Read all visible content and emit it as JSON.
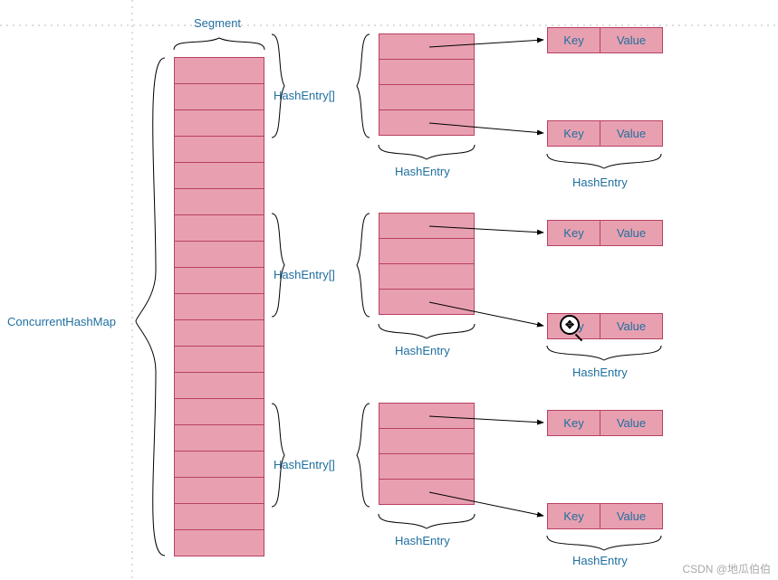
{
  "labels": {
    "root": "ConcurrentHashMap",
    "segment": "Segment",
    "hashEntryArr": "HashEntry[]",
    "hashEntry": "HashEntry",
    "key": "Key",
    "value": "Value"
  },
  "segmentCount": 19,
  "entryRowsPerBlock": 4,
  "watermark": "CSDN @地瓜伯伯",
  "colors": {
    "fill": "#e8a0b0",
    "border": "#b94061",
    "text": "#1f6f9f"
  }
}
